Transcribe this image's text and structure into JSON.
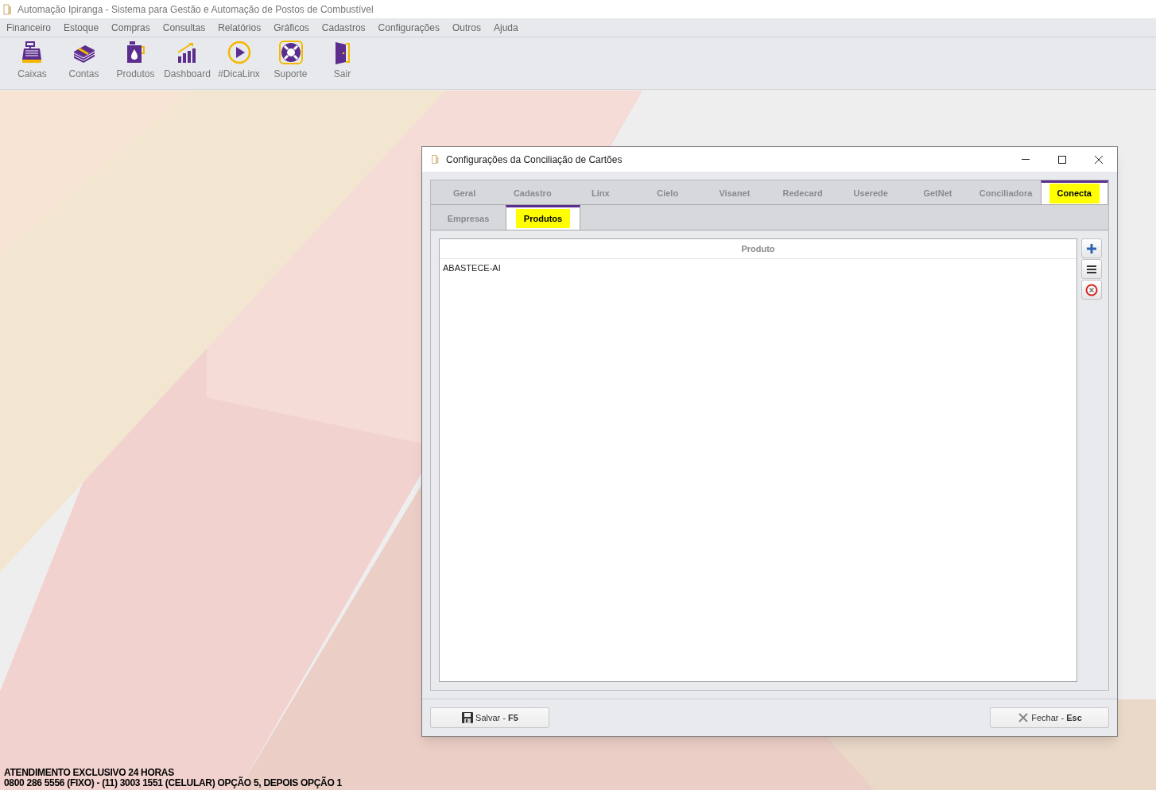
{
  "app_window": {
    "title": "Automação Ipiranga - Sistema para Gestão e Automação de Postos de Combustível"
  },
  "menu": [
    "Financeiro",
    "Estoque",
    "Compras",
    "Consultas",
    "Relatórios",
    "Gráficos",
    "Cadastros",
    "Configurações",
    "Outros",
    "Ajuda"
  ],
  "toolbar": [
    {
      "kind": "register",
      "label": "Caixas"
    },
    {
      "kind": "money",
      "label": "Contas"
    },
    {
      "kind": "jug",
      "label": "Produtos"
    },
    {
      "kind": "chart",
      "label": "Dashboard"
    },
    {
      "kind": "play",
      "label": "#DicaLinx"
    },
    {
      "kind": "lifebuoy",
      "label": "Suporte"
    },
    {
      "kind": "door",
      "label": "Sair"
    }
  ],
  "dialog": {
    "title": "Configurações da Conciliação de Cartões",
    "tabs": [
      {
        "label": "Geral",
        "selected": false,
        "highlighted": false
      },
      {
        "label": "Cadastro",
        "selected": false,
        "highlighted": false
      },
      {
        "label": "Linx",
        "selected": false,
        "highlighted": false
      },
      {
        "label": "Cielo",
        "selected": false,
        "highlighted": false
      },
      {
        "label": "Visanet",
        "selected": false,
        "highlighted": false
      },
      {
        "label": "Redecard",
        "selected": false,
        "highlighted": false
      },
      {
        "label": "Userede",
        "selected": false,
        "highlighted": false
      },
      {
        "label": "GetNet",
        "selected": false,
        "highlighted": false
      },
      {
        "label": "Conciliadora",
        "selected": false,
        "highlighted": false
      },
      {
        "label": "Conecta",
        "selected": true,
        "highlighted": true
      }
    ],
    "subtabs": [
      {
        "label": "Empresas",
        "selected": false,
        "highlighted": false
      },
      {
        "label": "Produtos",
        "selected": true,
        "highlighted": true
      }
    ],
    "table": {
      "columns": [
        "Produto"
      ],
      "rows": [
        [
          "ABASTECE-AI"
        ]
      ]
    },
    "side_buttons": [
      {
        "kind": "add"
      },
      {
        "kind": "list"
      },
      {
        "kind": "remove"
      }
    ],
    "buttons": [
      {
        "kind": "save",
        "label": "Salvar - **F5**"
      },
      {
        "kind": "close",
        "label": "Fechar - **Esc**"
      }
    ]
  },
  "footer": [
    "ATENDIMENTO EXCLUSIVO 24 HORAS",
    "0800 286 5556 (FIXO) - (11) 3003 1551 (CELULAR) OPÇÃO 5, DEPOIS OPÇÃO 1"
  ]
}
